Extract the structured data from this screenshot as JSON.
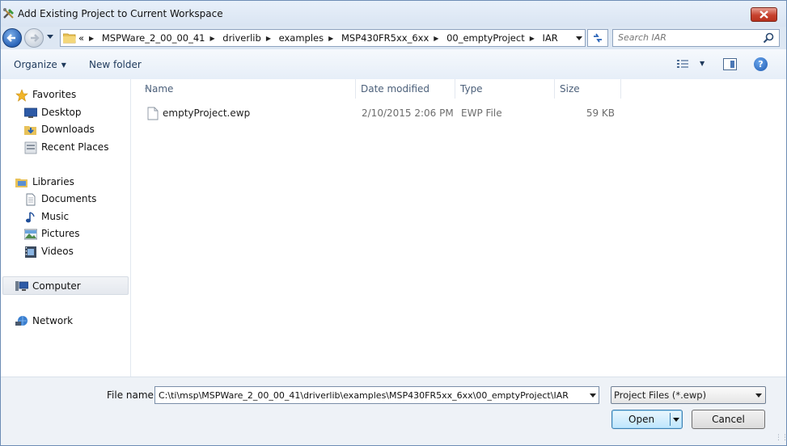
{
  "window": {
    "title": "Add Existing Project to Current Workspace"
  },
  "address": {
    "overflow": "«",
    "crumbs": [
      "MSPWare_2_00_00_41",
      "driverlib",
      "examples",
      "MSP430FR5xx_6xx",
      "00_emptyProject",
      "IAR"
    ],
    "search_placeholder": "Search IAR"
  },
  "toolbar": {
    "organize_label": "Organize",
    "new_folder_label": "New folder"
  },
  "nav": {
    "favorites": "Favorites",
    "desktop": "Desktop",
    "downloads": "Downloads",
    "recent_places": "Recent Places",
    "libraries": "Libraries",
    "documents": "Documents",
    "music": "Music",
    "pictures": "Pictures",
    "videos": "Videos",
    "computer": "Computer",
    "network": "Network"
  },
  "columns": {
    "name": "Name",
    "date_modified": "Date modified",
    "type": "Type",
    "size": "Size"
  },
  "files": [
    {
      "name": "emptyProject.ewp",
      "date_modified": "2/10/2015 2:06 PM",
      "type": "EWP File",
      "size": "59 KB"
    }
  ],
  "bottom": {
    "file_name_label": "File name:",
    "file_name_value": "C:\\ti\\msp\\MSPWare_2_00_00_41\\driverlib\\examples\\MSP430FR5xx_6xx\\00_emptyProject\\IAR",
    "filter_value": "Project Files (*.ewp)",
    "open_label": "Open",
    "cancel_label": "Cancel"
  },
  "colors": {
    "accent": "#2a64b8",
    "close": "#c7422e",
    "link_text": "#1e395b"
  }
}
